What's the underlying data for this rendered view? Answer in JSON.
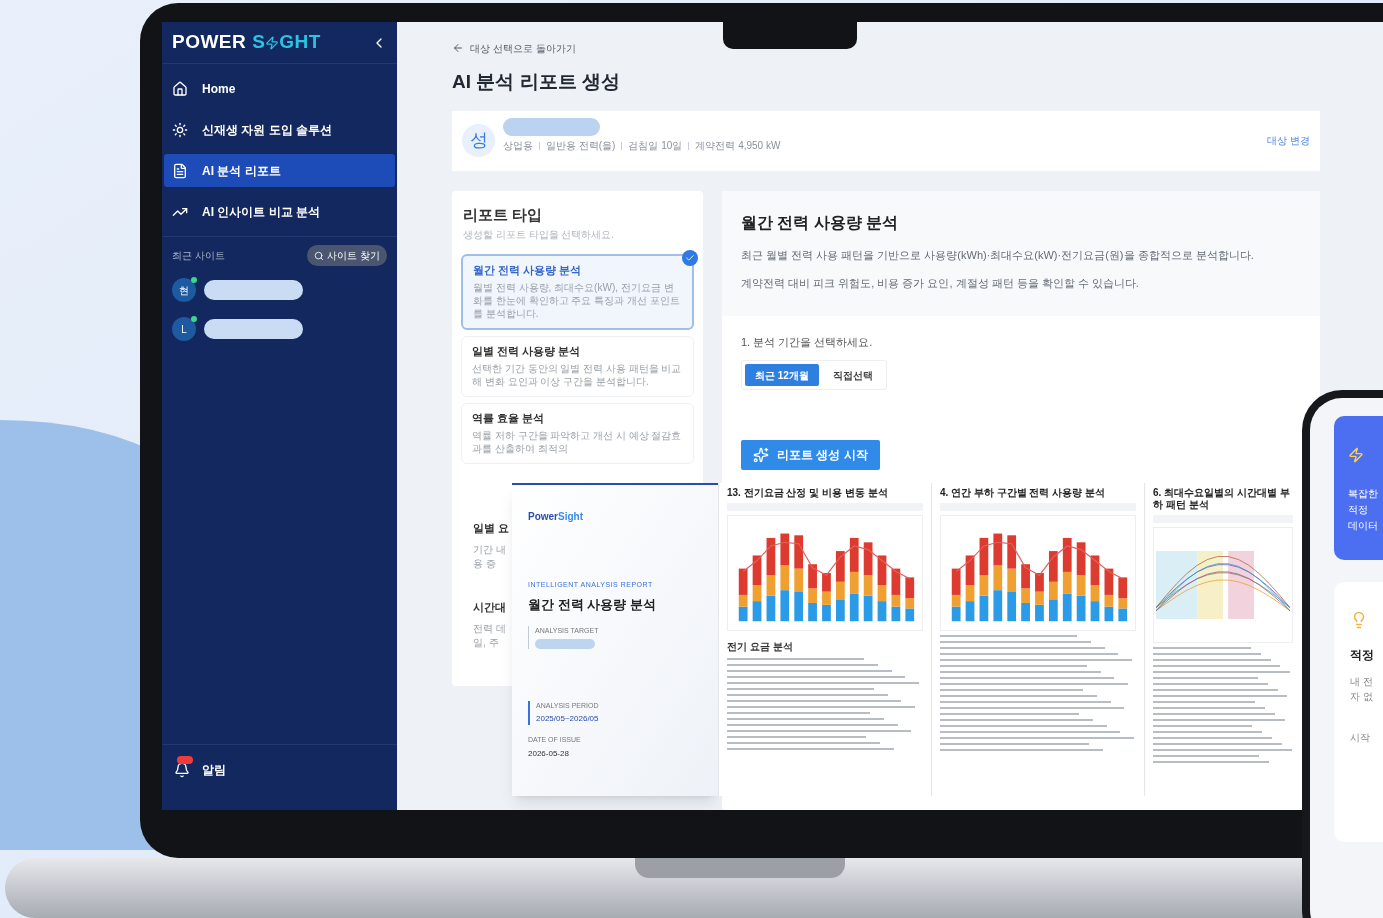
{
  "sidebar": {
    "logo": {
      "first": "POWER",
      "second_start": "S",
      "second_end": "GHT"
    },
    "items": [
      {
        "label": "Home",
        "selected": false
      },
      {
        "label": "신재생 자원 도입 솔루션",
        "selected": false
      },
      {
        "label": "AI 분석 리포트",
        "selected": true
      },
      {
        "label": "AI 인사이트 비교 분석",
        "selected": false
      }
    ],
    "recent_label": "최근 사이트",
    "find_button": "사이트 찾기",
    "sites": [
      {
        "initial": "현",
        "online": true
      },
      {
        "initial": "L",
        "online": true
      }
    ],
    "notifications": {
      "label": "알림",
      "unread": true
    }
  },
  "back_link": "대상 선택으로 돌아가기",
  "page_title": "AI 분석 리포트 생성",
  "target": {
    "initial": "성",
    "meta": [
      "상업용",
      "일반용 전력(을)",
      "검침일 10일",
      "계약전력 4,950 kW"
    ],
    "change_link": "대상 변경"
  },
  "report_types": {
    "title": "리포트 타입",
    "hint": "생성할 리포트 타입을 선택하세요.",
    "options": [
      {
        "kind": "card",
        "title": "월간 전력 사용량 분석",
        "lines": [
          "월별 전력 사용량, 최대수요(kW), 전기요금 변화를 한눈에 확인하고 주요 특징과 개선 포인트를 분석합니다."
        ],
        "selected": true
      },
      {
        "kind": "card",
        "title": "일별 전력 사용량 분석",
        "lines": [
          "선택한 기간 동안의 일별 전력 사용 패턴을 비교해 변화 요인과 이상 구간을 분석합니다."
        ],
        "selected": false
      },
      {
        "kind": "card",
        "title": "역률 효율 분석",
        "lines": [
          "역률 저하 구간을 파악하고 개선 시 예상 절감효과를 산출하여 최적의"
        ],
        "selected": false
      },
      {
        "kind": "peek",
        "title": "일별 요",
        "lines": [
          "기간 내",
          "용 증"
        ],
        "selected": false
      },
      {
        "kind": "peek",
        "title": "시간대",
        "lines": [
          "전력 데",
          "일, 주"
        ],
        "selected": false
      }
    ]
  },
  "detail": {
    "title": "월간 전력 사용량 분석",
    "paragraphs": [
      "최근 월별 전력 사용 패턴을 기반으로 사용량(kWh)·최대수요(kW)·전기요금(원)을 종합적으로 분석합니다.",
      "계약전력 대비 피크 위험도, 비용 증가 요인, 계절성 패턴 등을 확인할 수 있습니다."
    ],
    "step": "1. 분석 기간을 선택하세요.",
    "periods": [
      {
        "label": "최근 12개월",
        "selected": true
      },
      {
        "label": "직접선택",
        "selected": false
      }
    ],
    "start_button": "리포트 생성 시작"
  },
  "report_preview": {
    "cover": {
      "brand_first": "Power",
      "brand_second": "Sight",
      "eyebrow": "INTELLIGENT ANALYSIS REPORT",
      "title": "월간 전력 사용량 분석",
      "target_label": "ANALYSIS TARGET",
      "period_label": "ANALYSIS PERIOD",
      "period": "2025/05~2026/05",
      "issue_label": "DATE OF ISSUE",
      "issue_date": "2026-05-28"
    },
    "pages": [
      {
        "kind": "bars",
        "title": "13. 전기요금 산정 및 비용 변동 분석",
        "section": "전기 요금 분석"
      },
      {
        "kind": "bars",
        "title": "4. 연간 부하 구간별 전력 사용량 분석"
      },
      {
        "kind": "lines",
        "title": "6. 최대수요일별의 시간대별 부하 패턴 분석"
      }
    ]
  },
  "phone": {
    "hero_lines": [
      "복잡한",
      "적정",
      "데이터"
    ],
    "card_title": "적정",
    "card_lines": [
      "내 전",
      "자 없"
    ],
    "card_action": "시작"
  }
}
